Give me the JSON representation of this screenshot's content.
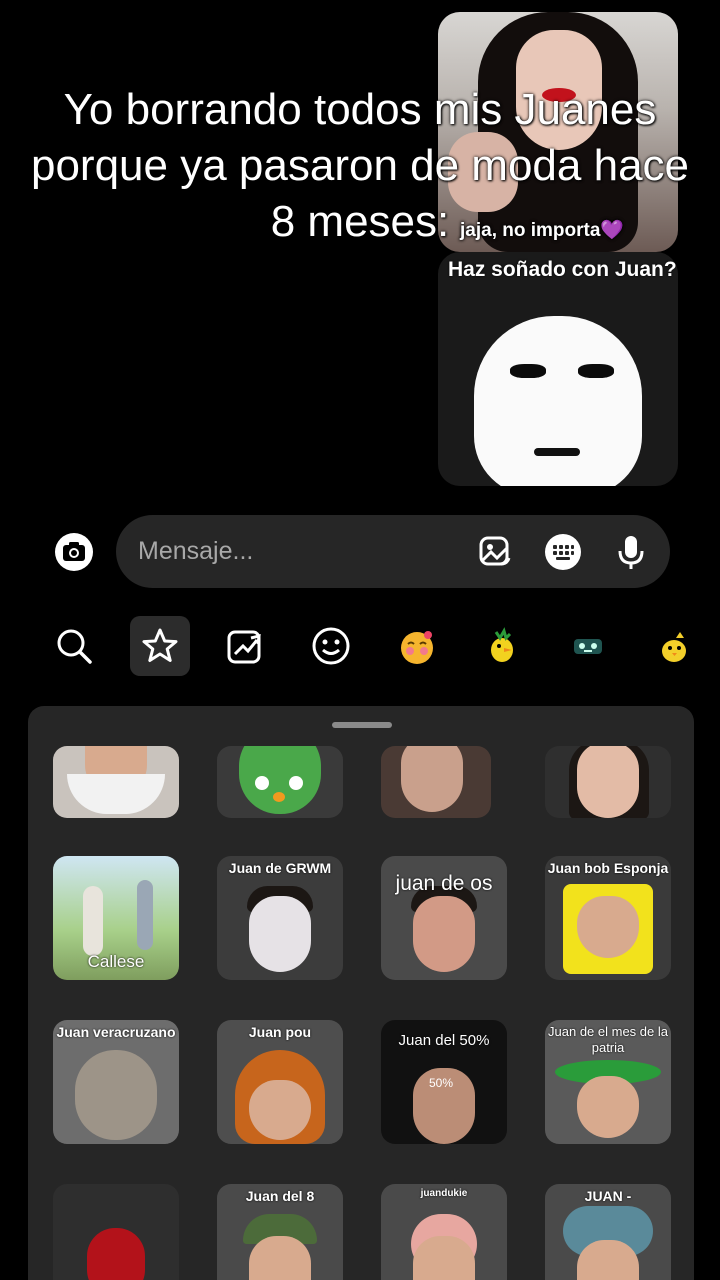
{
  "overlay": {
    "meme_text": "Yo borrando todos mis Juanes porque ya pasaron de moda hace 8 meses:"
  },
  "chat": {
    "sticker_top_caption": "jaja, no importa",
    "sticker_top_emoji": "💜",
    "sticker_bottom_caption": "Haz soñado con Juan?"
  },
  "message_bar": {
    "placeholder": "Mensaje...",
    "icons": [
      "camera-icon",
      "gallery-sticker-icon",
      "keyboard-icon",
      "microphone-icon"
    ]
  },
  "sticker_tabs": [
    {
      "name": "search",
      "icon": "search-icon"
    },
    {
      "name": "favorites",
      "icon": "star-icon",
      "active": true
    },
    {
      "name": "trending",
      "icon": "trending-icon"
    },
    {
      "name": "emoji",
      "icon": "smiley-icon"
    },
    {
      "name": "pack-1",
      "icon": "blush-emoji-icon"
    },
    {
      "name": "pack-2",
      "icon": "bird-sticker-icon"
    },
    {
      "name": "pack-3",
      "icon": "robot-sticker-icon"
    },
    {
      "name": "pack-4",
      "icon": "duck-sticker-icon"
    }
  ],
  "stickers": {
    "row1": [
      "",
      "",
      "",
      ""
    ],
    "row2": [
      "Callese",
      "Juan de GRWM",
      "juan de os",
      "Juan bob Esponja"
    ],
    "row3": [
      "Juan veracruzano",
      "Juan pou",
      "Juan del 50%",
      "Juan de el mes de la patria"
    ],
    "row3_badge": "50%",
    "row4": [
      "",
      "Juan del 8",
      "juandukie",
      "JUAN -"
    ]
  },
  "colors": {
    "background": "#000000",
    "panel": "#262626",
    "input": "#262626",
    "placeholder": "#a8a8a8"
  }
}
